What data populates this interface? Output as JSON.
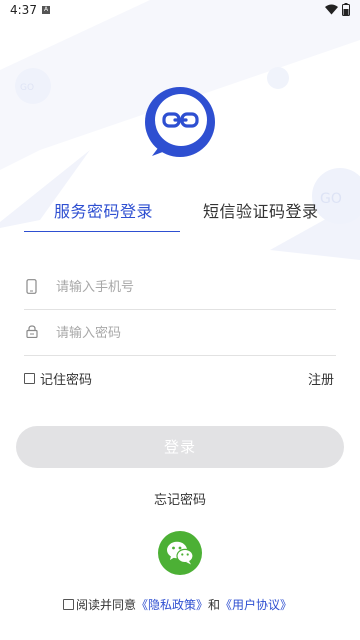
{
  "status_bar": {
    "time": "4:37",
    "notification_icon": "a-icon",
    "wifi_icon": "wifi-icon",
    "battery_icon": "battery-icon"
  },
  "logo": {
    "icon": "link-icon",
    "accent_color": "#2e4fd1"
  },
  "tabs": [
    {
      "label": "服务密码登录",
      "active": true
    },
    {
      "label": "短信验证码登录",
      "active": false
    }
  ],
  "form": {
    "phone": {
      "placeholder": "请输入手机号",
      "value": "",
      "icon": "phone-icon"
    },
    "password": {
      "placeholder": "请输入密码",
      "value": "",
      "icon": "lock-icon"
    },
    "remember_label": "记住密码",
    "remember_checked": false,
    "register_label": "注册",
    "login_label": "登录",
    "forgot_label": "忘记密码"
  },
  "social": {
    "wechat_icon": "wechat-icon",
    "color": "#4cb035"
  },
  "agreement": {
    "prefix": "阅读并同意",
    "privacy_link": "《隐私政策》",
    "and": "和",
    "user_link": "《用户协议》",
    "checked": false
  }
}
